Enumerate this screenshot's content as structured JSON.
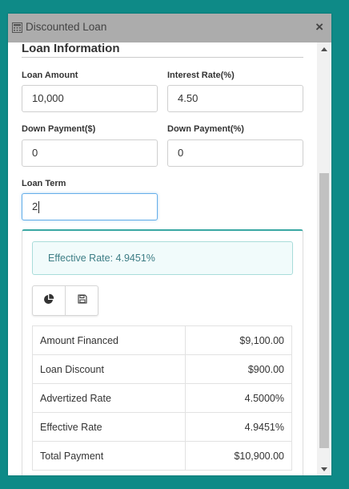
{
  "window": {
    "title": "Discounted Loan",
    "title_icon": "calculator-icon",
    "close_label": "×"
  },
  "section": {
    "title": "Loan Information"
  },
  "fields": {
    "loan_amount": {
      "label": "Loan Amount",
      "value": "10,000"
    },
    "interest_rate": {
      "label": "Interest Rate(%)",
      "value": "4.50"
    },
    "down_payment_amount": {
      "label": "Down Payment($)",
      "value": "0"
    },
    "down_payment_percent": {
      "label": "Down Payment(%)",
      "value": "0"
    },
    "loan_term": {
      "label": "Loan Term",
      "value": "2"
    }
  },
  "result": {
    "alert": "Effective Rate: 4.9451%",
    "buttons": [
      {
        "icon": "pie-chart-icon"
      },
      {
        "icon": "save-icon"
      }
    ],
    "rows": [
      {
        "label": "Amount Financed",
        "value": "$9,100.00"
      },
      {
        "label": "Loan Discount",
        "value": "$900.00"
      },
      {
        "label": "Advertized Rate",
        "value": "4.5000%"
      },
      {
        "label": "Effective Rate",
        "value": "4.9451%"
      },
      {
        "label": "Total Payment",
        "value": "$10,900.00"
      }
    ]
  },
  "colors": {
    "background": "#0e8a87",
    "titlebar": "#acacac",
    "panel_accent": "#3aa8a3",
    "alert_bg": "#f1fbfb",
    "alert_text": "#3d7d85"
  }
}
